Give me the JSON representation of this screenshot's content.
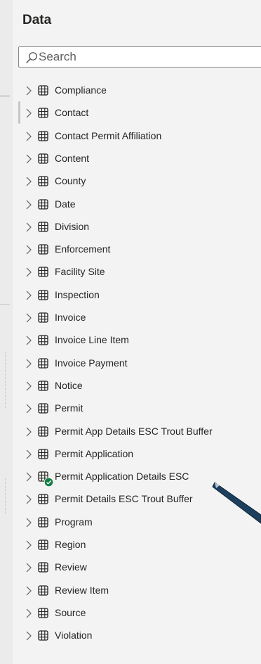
{
  "panel": {
    "title": "Data",
    "search": {
      "placeholder": "Search",
      "value": ""
    }
  },
  "tables": [
    {
      "label": "Compliance"
    },
    {
      "label": "Contact"
    },
    {
      "label": "Contact Permit Affiliation"
    },
    {
      "label": "Content"
    },
    {
      "label": "County"
    },
    {
      "label": "Date"
    },
    {
      "label": "Division"
    },
    {
      "label": "Enforcement"
    },
    {
      "label": "Facility Site"
    },
    {
      "label": "Inspection"
    },
    {
      "label": "Invoice"
    },
    {
      "label": "Invoice Line Item"
    },
    {
      "label": "Invoice Payment"
    },
    {
      "label": "Notice"
    },
    {
      "label": "Permit"
    },
    {
      "label": "Permit App Details ESC Trout Buffer"
    },
    {
      "label": "Permit Application"
    },
    {
      "label": "Permit Application Details ESC",
      "status": "check"
    },
    {
      "label": "Permit Details ESC Trout Buffer"
    },
    {
      "label": "Program"
    },
    {
      "label": "Region"
    },
    {
      "label": "Review"
    },
    {
      "label": "Review Item"
    },
    {
      "label": "Source"
    },
    {
      "label": "Violation"
    }
  ],
  "icons": {
    "search": "search-icon",
    "expand": "chevron-right-icon",
    "table": "table-icon",
    "status": "check-badge-icon",
    "annotation": "arrow-icon"
  },
  "colors": {
    "panel_bg": "#f3f3f3",
    "text": "#252423",
    "check_badge": "#107c41",
    "arrow_fill": "#1d3f5e"
  }
}
